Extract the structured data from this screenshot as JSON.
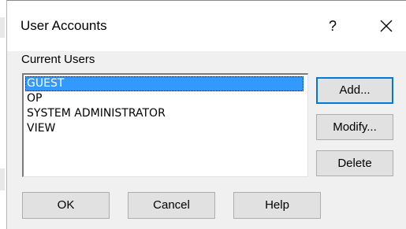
{
  "window": {
    "title": "User Accounts",
    "help_glyph": "?",
    "close_icon": "close-icon"
  },
  "users": {
    "label": "Current Users",
    "items": [
      "GUEST",
      "OP",
      "SYSTEM ADMINISTRATOR",
      "VIEW"
    ],
    "selected_index": 0
  },
  "side_buttons": {
    "add": "Add...",
    "modify": "Modify...",
    "delete": "Delete"
  },
  "bottom_buttons": {
    "ok": "OK",
    "cancel": "Cancel",
    "help": "Help"
  },
  "colors": {
    "selection": "#3399ff",
    "default_button_border": "#0078d7",
    "dialog_bg": "#f0f0f0"
  }
}
